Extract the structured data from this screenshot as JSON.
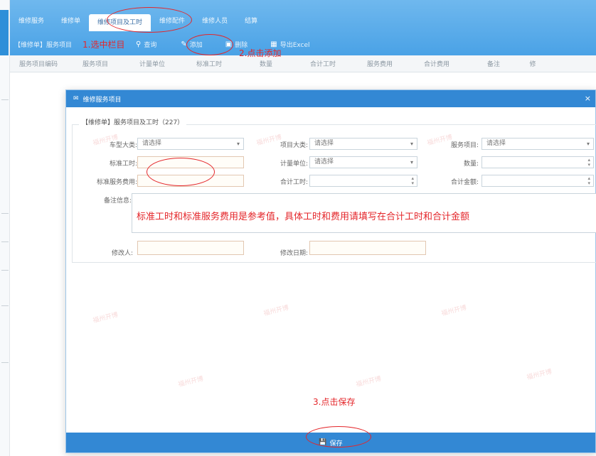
{
  "header": {
    "tabs": [
      {
        "label": "维修服务"
      },
      {
        "label": "维修单"
      },
      {
        "label": "维修项目及工时"
      },
      {
        "label": "维修配件"
      },
      {
        "label": "维修人员"
      },
      {
        "label": "结算"
      }
    ],
    "toolbar": {
      "breadcrumb": "【维修单】服务项目",
      "search_label": "查询",
      "add_label": "添加",
      "delete_label": "删除",
      "export_label": "导出Excel"
    }
  },
  "grid": {
    "columns": [
      "服务项目编码",
      "服务项目",
      "计量单位",
      "标准工时",
      "数量",
      "合计工时",
      "服务费用",
      "合计费用",
      "备注",
      "修"
    ]
  },
  "modal": {
    "title": "维修服务项目",
    "close_glyph": "×",
    "legend": "【维修单】服务项目及工时（227）",
    "fields": {
      "car_type_label": "车型大类:",
      "car_type_value": "请选择",
      "item_category_label": "项目大类:",
      "item_category_value": "请选择",
      "service_item_label": "服务项目:",
      "service_item_value": "请选择",
      "std_hours_label": "标准工时:",
      "unit_label": "计量单位:",
      "unit_value": "请选择",
      "quantity_label": "数量:",
      "std_fee_label": "标准服务费用:",
      "total_hours_label": "合计工时:",
      "total_amount_label": "合计金额:",
      "remark_label": "备注信息:",
      "modifier_label": "修改人:",
      "modify_date_label": "修改日期:"
    },
    "save_label": "保存"
  },
  "annotations": {
    "step1": "1.选中栏目",
    "step2": "2.点击添加",
    "step3": "3.点击保存",
    "note": "标准工时和标准服务费用是参考值，具体工时和费用请填写在合计工时和合计金额"
  },
  "watermark_text": "福州开博",
  "icons": {
    "dropdown": "▾",
    "spinner_up": "▴",
    "spinner_down": "▾"
  },
  "colors": {
    "header_blue": "#4aa2e6",
    "modal_blue": "#3388d4",
    "annotation_red": "#e4262a"
  }
}
